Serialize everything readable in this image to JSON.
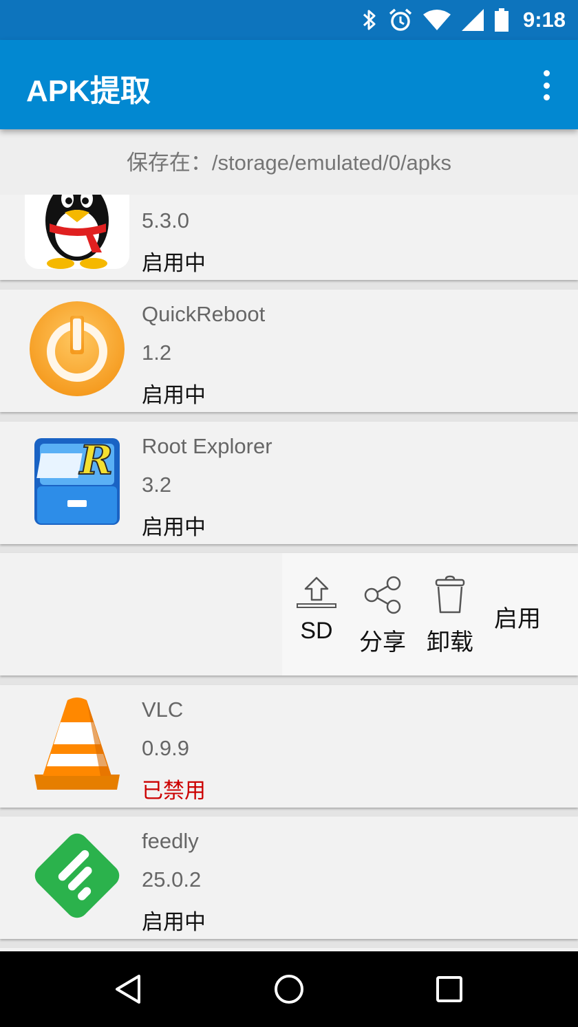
{
  "status_bar": {
    "time": "9:18",
    "icons": [
      "bluetooth-icon",
      "alarm-icon",
      "wifi-icon",
      "signal-icon",
      "battery-icon"
    ]
  },
  "app_bar": {
    "title": "APK提取",
    "menu_icon": "overflow-menu-icon"
  },
  "save_path": "保存在：/storage/emulated/0/apks",
  "apps": [
    {
      "name": "",
      "version": "5.3.0",
      "status": "启用中",
      "icon": "qq-penguin-icon"
    },
    {
      "name": "QuickReboot",
      "version": "1.2",
      "status": "启用中",
      "icon": "quickreboot-icon"
    },
    {
      "name": "Root Explorer",
      "version": "3.2",
      "status": "启用中",
      "icon": "root-explorer-icon"
    },
    {
      "name": "VLC",
      "version": "0.9.9",
      "status": "已禁用",
      "icon": "vlc-cone-icon"
    },
    {
      "name": "feedly",
      "version": "25.0.2",
      "status": "启用中",
      "icon": "feedly-icon"
    }
  ],
  "actions": {
    "sd": "SD",
    "share": "分享",
    "uninstall": "卸载",
    "enable": "启用"
  },
  "colors": {
    "status_bar": "#0d74bd",
    "app_bar": "#0288d1",
    "disabled_status": "#cc0000"
  },
  "nav": [
    "back-icon",
    "home-icon",
    "recents-icon"
  ]
}
